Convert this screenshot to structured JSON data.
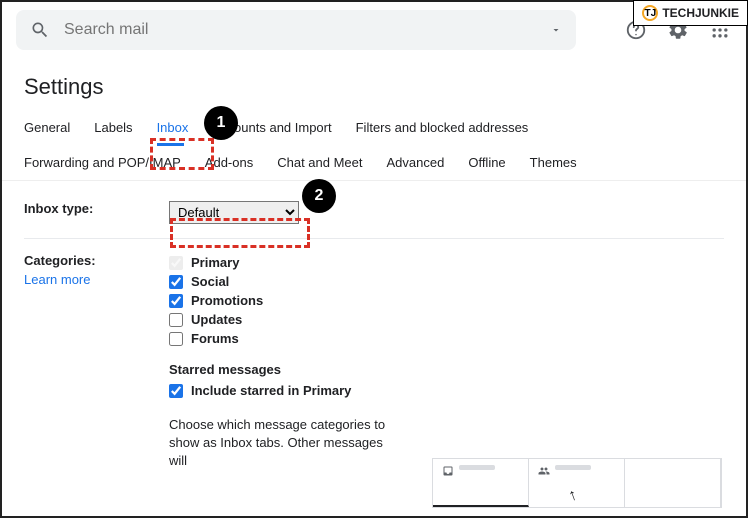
{
  "watermark": {
    "text": "TECHJUNKIE",
    "icon_letter": "TJ"
  },
  "search": {
    "placeholder": "Search mail"
  },
  "page_title": "Settings",
  "tabs_row1": [
    {
      "label": "General",
      "active": false
    },
    {
      "label": "Labels",
      "active": false
    },
    {
      "label": "Inbox",
      "active": true
    },
    {
      "label": "Accounts and Import",
      "active": false
    },
    {
      "label": "Filters and blocked addresses",
      "active": false
    }
  ],
  "tabs_row2": [
    {
      "label": "Forwarding and POP/IMAP"
    },
    {
      "label": "Add-ons"
    },
    {
      "label": "Chat and Meet"
    },
    {
      "label": "Advanced"
    },
    {
      "label": "Offline"
    },
    {
      "label": "Themes"
    }
  ],
  "callouts": {
    "one": "1",
    "two": "2"
  },
  "inbox_type": {
    "label": "Inbox type:",
    "value": "Default"
  },
  "categories": {
    "label": "Categories:",
    "learn_more": "Learn more",
    "items": [
      {
        "label": "Primary",
        "checked": true,
        "disabled": true
      },
      {
        "label": "Social",
        "checked": true,
        "disabled": false
      },
      {
        "label": "Promotions",
        "checked": true,
        "disabled": false
      },
      {
        "label": "Updates",
        "checked": false,
        "disabled": false
      },
      {
        "label": "Forums",
        "checked": false,
        "disabled": false
      }
    ],
    "starred_heading": "Starred messages",
    "starred_item": {
      "label": "Include starred in Primary",
      "checked": true
    },
    "desc": "Choose which message categories to show as Inbox tabs. Other messages will"
  }
}
